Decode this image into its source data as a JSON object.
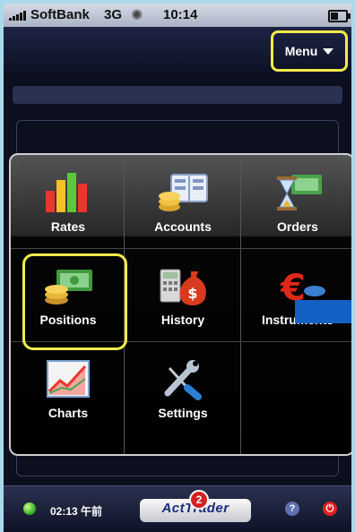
{
  "status_bar": {
    "carrier": "SoftBank",
    "network": "3G",
    "time": "10:14"
  },
  "nav": {
    "menu_label": "Menu"
  },
  "grid": {
    "rates": "Rates",
    "accounts": "Accounts",
    "orders": "Orders",
    "positions": "Positions",
    "history": "History",
    "instruments": "Instruments",
    "charts": "Charts",
    "settings": "Settings"
  },
  "bottom": {
    "time": "02:13 午前",
    "logo": "ActTrader",
    "badge_count": "2",
    "help": "?",
    "power": "⏻"
  },
  "colors": {
    "highlight": "#f2ea4a",
    "background": "#a9d9ea",
    "blue_block": "#1560c4"
  }
}
